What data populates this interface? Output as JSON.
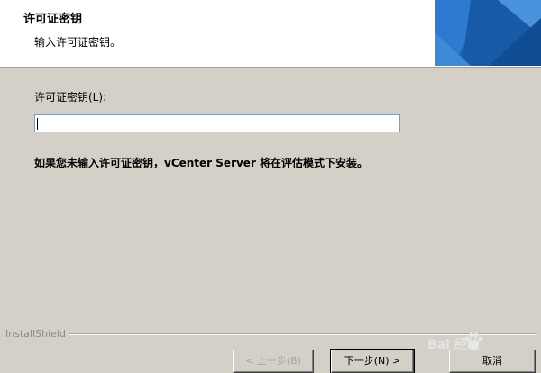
{
  "header": {
    "title": "许可证密钥",
    "subtitle": "输入许可证密钥。"
  },
  "form": {
    "license_label": "许可证密钥(L):",
    "license_value": "",
    "info_text": "如果您未输入许可证密钥，vCenter Server 将在评估模式下安装。"
  },
  "footer": {
    "brand": "InstallShield",
    "back_label": "< 上一步(B)",
    "next_label": "下一步(N) >",
    "cancel_label": "取消"
  },
  "watermark": {
    "text": "Bai 经验"
  },
  "colors": {
    "dialog_bg": "#d4d0c8",
    "header_bg": "#ffffff",
    "header_graphic": "#1a5aa8"
  }
}
